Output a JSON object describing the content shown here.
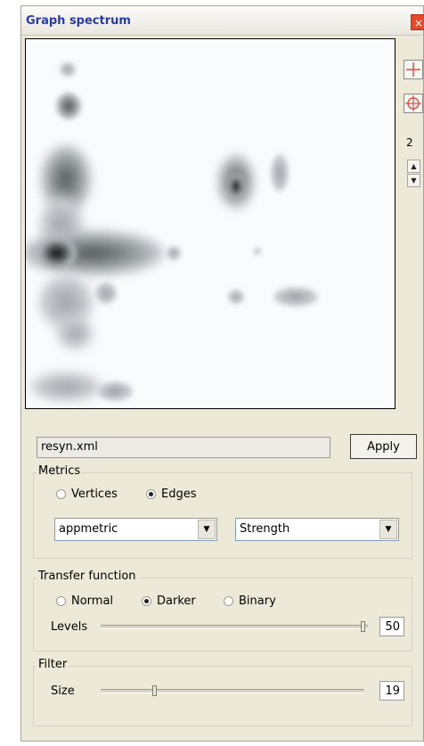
{
  "window": {
    "title": "Graph spectrum",
    "close_glyph": "×"
  },
  "side_toolbar": {
    "crosshair_icon": "crosshair-icon",
    "target_icon": "target-icon",
    "value": "2",
    "spin_up": "▲",
    "spin_down": "▼"
  },
  "file_field": {
    "value": "resyn.xml"
  },
  "apply_label": "Apply",
  "metrics": {
    "title": "Metrics",
    "radios": [
      {
        "label": "Vertices",
        "selected": false
      },
      {
        "label": "Edges",
        "selected": true
      }
    ],
    "metric_select": "appmetric",
    "measure_select": "Strength",
    "arrow_glyph": "▼"
  },
  "transfer": {
    "title": "Transfer function",
    "radios": [
      {
        "label": "Normal",
        "selected": false
      },
      {
        "label": "Darker",
        "selected": true
      },
      {
        "label": "Binary",
        "selected": false
      }
    ],
    "levels_label": "Levels",
    "levels_value": "50"
  },
  "filter": {
    "title": "Filter",
    "size_label": "Size",
    "size_value": "19"
  },
  "colors": {
    "title_text": "#2a3ca0",
    "panel_bg": "#ece9d8",
    "blob_dark": "#1a1a1a",
    "close_red": "#e24a2c"
  }
}
